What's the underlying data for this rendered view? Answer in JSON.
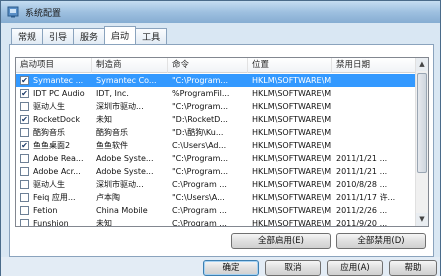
{
  "window": {
    "title": "系统配置"
  },
  "tabs": [
    "常规",
    "引导",
    "服务",
    "启动",
    "工具"
  ],
  "active_tab": 3,
  "columns": {
    "item": "启动项目",
    "manufacturer": "制造商",
    "command": "命令",
    "location": "位置",
    "disabled_date": "禁用日期"
  },
  "rows": [
    {
      "checked": true,
      "item": "Symantec ...",
      "manufacturer": "Symantec Co...",
      "command": "\"C:\\Program...",
      "location": "HKLM\\SOFTWARE\\M...",
      "date": "",
      "selected": true
    },
    {
      "checked": true,
      "item": "IDT PC Audio",
      "manufacturer": "IDT, Inc.",
      "command": "%ProgramFil...",
      "location": "HKLM\\SOFTWARE\\M...",
      "date": ""
    },
    {
      "checked": false,
      "item": "驱动人生",
      "manufacturer": "深圳市驱动...",
      "command": "\"C:\\Program...",
      "location": "HKLM\\SOFTWARE\\M...",
      "date": ""
    },
    {
      "checked": true,
      "item": "RocketDock",
      "manufacturer": "未知",
      "command": "\"D:\\RocketD...",
      "location": "HKLM\\SOFTWARE\\M...",
      "date": ""
    },
    {
      "checked": false,
      "item": "酷狗音乐",
      "manufacturer": "酷狗音乐",
      "command": "\"D:\\酷狗\\Ku...",
      "location": "HKLM\\SOFTWARE\\M...",
      "date": ""
    },
    {
      "checked": true,
      "item": "鱼鱼桌面2",
      "manufacturer": "鱼鱼软件",
      "command": "C:\\Users\\Ad...",
      "location": "HKLM\\SOFTWARE\\M...",
      "date": ""
    },
    {
      "checked": false,
      "item": "Adobe Rea...",
      "manufacturer": "Adobe Syste...",
      "command": "\"C:\\Program...",
      "location": "HKLM\\SOFTWARE\\M...",
      "date": "2011/1/21 ..."
    },
    {
      "checked": false,
      "item": "Adobe Acr...",
      "manufacturer": "Adobe Syste...",
      "command": "\"C:\\Program...",
      "location": "HKLM\\SOFTWARE\\M...",
      "date": "2011/1/21 ..."
    },
    {
      "checked": false,
      "item": "驱动人生",
      "manufacturer": "深圳市驱动...",
      "command": "C:\\Program ...",
      "location": "HKLM\\SOFTWARE\\M...",
      "date": "2010/8/28 ..."
    },
    {
      "checked": false,
      "item": "Feiq 应用...",
      "manufacturer": "卢本陶",
      "command": "\"C:\\Users\\A...",
      "location": "HKLM\\SOFTWARE\\M...",
      "date": "2011/1/17 许..."
    },
    {
      "checked": false,
      "item": "Fetion",
      "manufacturer": "China Mobile",
      "command": "C:\\Program ...",
      "location": "HKLM\\SOFTWARE\\M...",
      "date": "2011/2/26 ..."
    },
    {
      "checked": false,
      "item": "Funshion",
      "manufacturer": "未知",
      "command": "C:\\Program ...",
      "location": "HKLM\\SOFTWARE\\M...",
      "date": "2011/9/20 ..."
    }
  ],
  "buttons": {
    "enable_all": "全部启用(E)",
    "disable_all": "全部禁用(D)",
    "ok": "确定",
    "cancel": "取消",
    "apply": "应用(A)",
    "help": "帮助"
  },
  "icons": {
    "title_icon": "system-config-icon",
    "check": "✔"
  }
}
